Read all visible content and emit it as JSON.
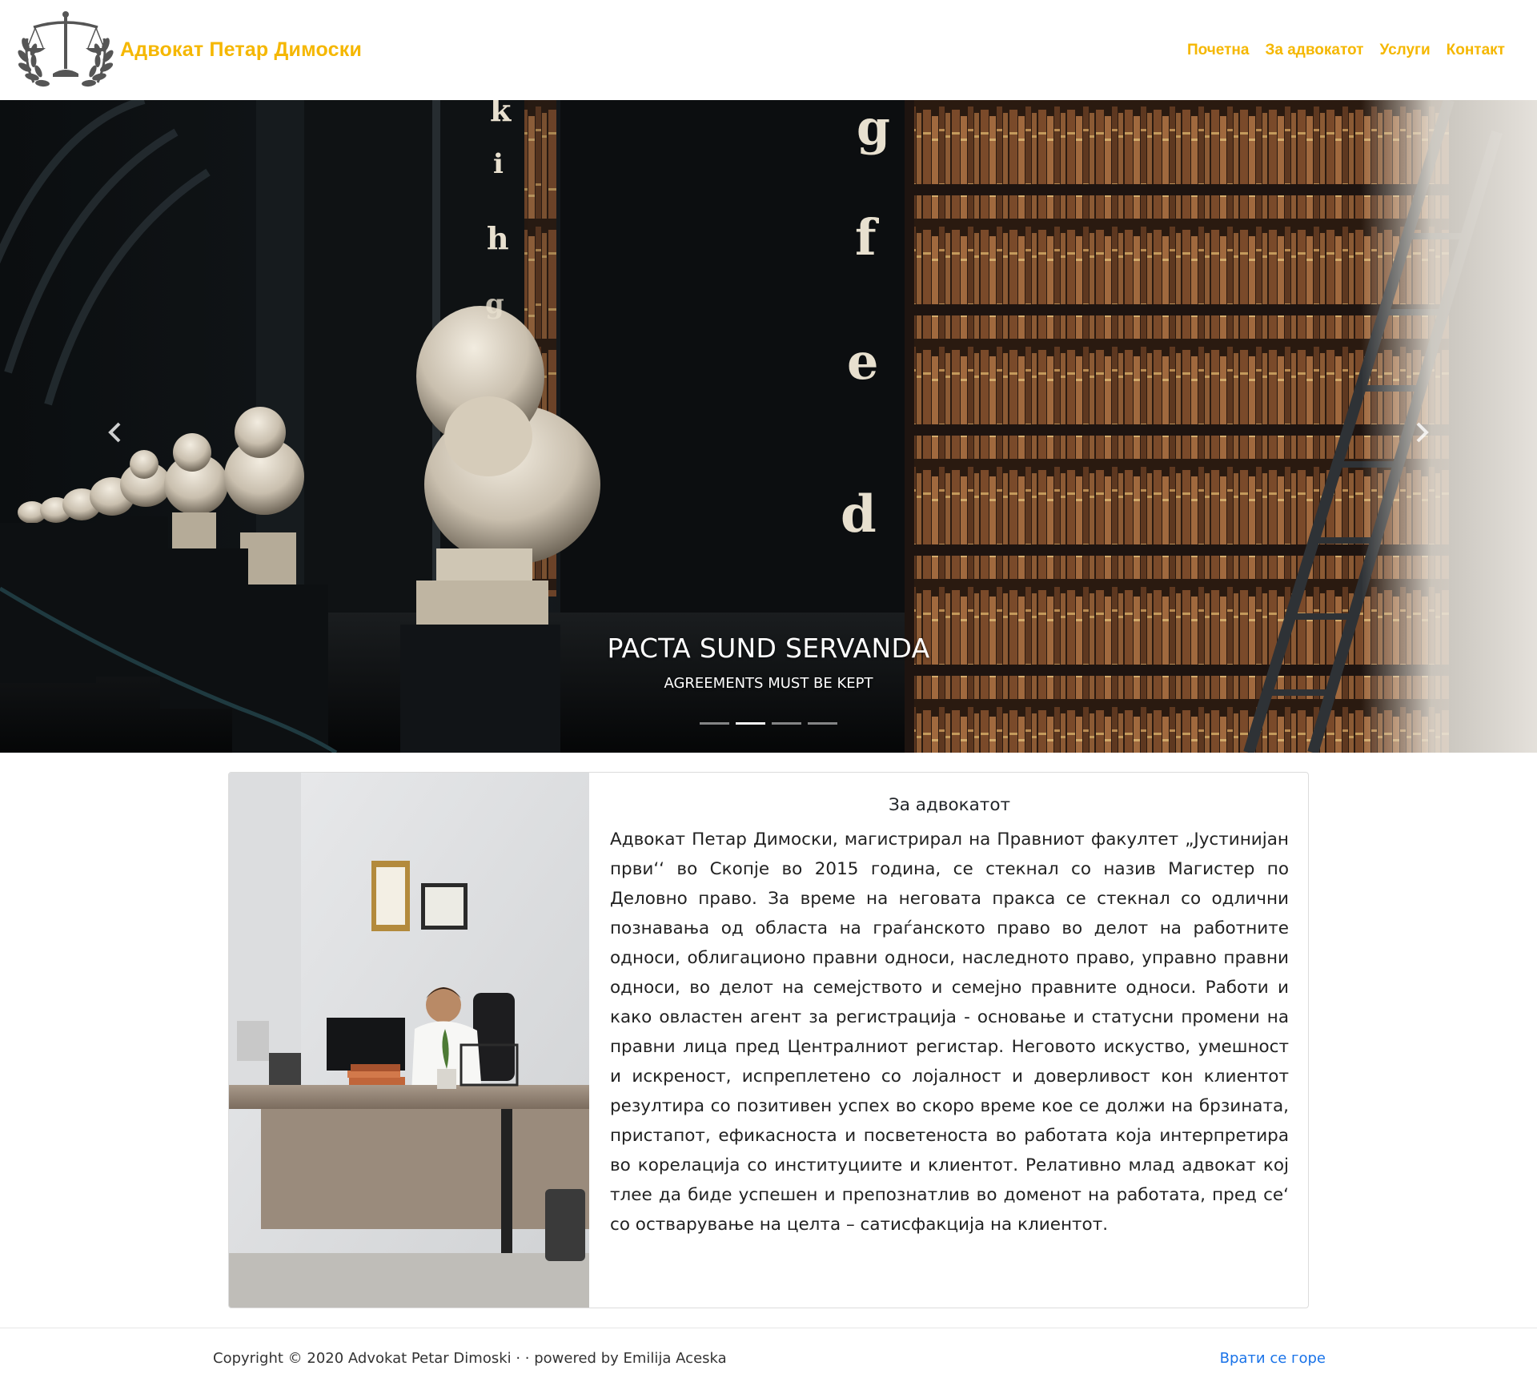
{
  "colors": {
    "brand": "#f5b700",
    "nav_link": "#f5b700",
    "link_blue": "#1a73e8"
  },
  "header": {
    "logo_icon": "scales-of-justice-laurel-icon",
    "brand_name": "Адвокат Петар Димоски",
    "nav": [
      {
        "label": "Почетна"
      },
      {
        "label": "За адвокатот"
      },
      {
        "label": "Услуги"
      },
      {
        "label": "Контакт"
      }
    ]
  },
  "carousel": {
    "caption_title": "PACTA SUND SERVANDA",
    "caption_subtitle": "AGREEMENTS MUST BE KEPT",
    "prev_icon": "chevron-left-icon",
    "next_icon": "chevron-right-icon",
    "slide_count": 4,
    "active_slide": 2,
    "shelf_letters": [
      "k",
      "i",
      "h",
      "g",
      "g",
      "f",
      "e",
      "d"
    ]
  },
  "about": {
    "title": "За адвокатот",
    "text": "Адвокат Петар Димоски, магистрирал на Правниот факултет „Јустинијан први‘‘ во Скопје во 2015 година, се стекнал со назив Магистер по Деловно право. За време на неговата пракса се стекнал со одлични познавања од областа на граѓанското право во делот на работните односи, облигационо правни односи, наследното право, управно правни односи, во делот на семејството и семејно правните односи. Работи и како овластен агент за регистрација - основање и статусни промени на правни лица пред Централниот регистар. Неговото искуство, умешност и искреност, испреплетено со лојалност и доверливост кон клиентот резултира со позитивен успех во скоро време кое се должи на брзината, пристапот, ефикасноста и посветеноста во работата која интерпретира во корелација со институциите и клиентот. Релативно млад адвокат кој тлее да биде успешен и препознатлив во доменот на работата, пред се‘ со остварување на целта – сатисфакција на клиентот."
  },
  "footer": {
    "copyright": "Copyright © 2020 Advokat Petar Dimoski · · powered by Emilija Aceska",
    "back_to_top": "Врати се горе"
  }
}
